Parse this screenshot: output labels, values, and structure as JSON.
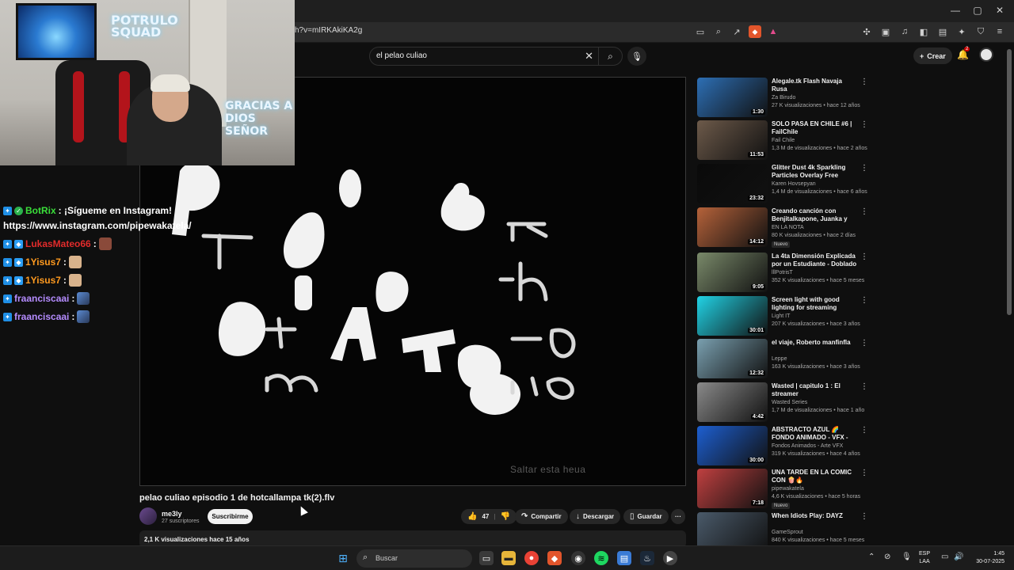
{
  "browser": {
    "url": "h?v=mIRKAkiKA2g",
    "window_controls": [
      "—",
      "▢",
      "✕"
    ]
  },
  "youtube": {
    "search_value": "el pelao culiao",
    "create_label": "Crear",
    "notification_count": "2"
  },
  "webcam": {
    "neon_sign_1": "POTRULO SQUAD",
    "neon_sign_2": "GRACIAS A DIOS SEÑOR"
  },
  "chat": [
    {
      "user": "BotRix",
      "color": "#3adf3a",
      "message": ": ¡Sígueme en Instagram!",
      "message2": "https://www.instagram.com/pipewakatela/"
    },
    {
      "user": "LukasMateo66",
      "color": "#e22b2b",
      "message": ":"
    },
    {
      "user": "1Yisus7",
      "color": "#ff9a1f",
      "message": ":"
    },
    {
      "user": "1Yisus7",
      "color": "#ff9a1f",
      "message": ":"
    },
    {
      "user": "fraanciscaai",
      "color": "#b58cff",
      "message": ":"
    },
    {
      "user": "fraanciscaai",
      "color": "#b58cff",
      "message": ":"
    }
  ],
  "video": {
    "skip_text": "Saltar esta  heua",
    "title": "pelao culiao episodio 1 de hotcallampa tk(2).flv",
    "channel": "me3ly",
    "subscribers": "27 suscriptores",
    "subscribe_label": "Suscribirme",
    "likes": "47",
    "share_label": "Compartir",
    "download_label": "Descargar",
    "save_label": "Guardar",
    "views_date": "2,1 K visualizaciones  hace 15 años"
  },
  "recommendations": [
    {
      "title": "Alegale.tk Flash Navaja Rusa",
      "channel": "Za Birudo",
      "meta": "27 K visualizaciones • hace 12 años",
      "duration": "1:30",
      "color": "#2d6fb5",
      "isnew": ""
    },
    {
      "title": "SOLO PASA EN CHILE #6 | FailChile",
      "channel": "Fail Chile",
      "meta": "1,3 M de visualizaciones • hace 2 años",
      "duration": "11:53",
      "color": "#6d5a4a",
      "isnew": ""
    },
    {
      "title": "Glitter Dust 4k Sparkling Particles Overlay Free Footage...",
      "channel": "Karen Hovsepyan",
      "meta": "1,4 M de visualizaciones • hace 6 años",
      "duration": "23:32",
      "color": "#0a0a0a",
      "isnew": ""
    },
    {
      "title": "Creando canción con Benjitalkapone, Juanka y Fran...",
      "channel": "EN LA NOTA",
      "meta": "80 K visualizaciones • hace 2 días",
      "duration": "14:12",
      "color": "#b5623a",
      "isnew": "Nuevo"
    },
    {
      "title": "La 4ta Dimensión Explicada por un Estudiante - Doblado al ...",
      "channel": "lllPotrisT",
      "meta": "352 K visualizaciones • hace 5 meses",
      "duration": "9:05",
      "color": "#7a8a6a",
      "isnew": ""
    },
    {
      "title": "Screen light with good lighting for streaming",
      "channel": "Light IT",
      "meta": "207 K visualizaciones • hace 3 años",
      "duration": "30:01",
      "color": "#21d3e6",
      "isnew": ""
    },
    {
      "title": "el viaje, Roberto manfinfla",
      "channel": "Leppe",
      "meta": "163 K visualizaciones • hace 3 años",
      "duration": "12:32",
      "color": "#7aa0b0",
      "isnew": ""
    },
    {
      "title": "Wasted | capitulo 1 : El streamer",
      "channel": "Wasted Series",
      "meta": "1,7 M de visualizaciones • hace 1 año",
      "duration": "4:42",
      "color": "#8a8a8a",
      "isnew": ""
    },
    {
      "title": "ABSTRACTO AZUL 🌈 FONDO ANIMADO - VFX - GRATIS ✅ ...",
      "channel": "Fondos Animados - Arte VFX",
      "meta": "319 K visualizaciones • hace 4 años",
      "duration": "30:00",
      "color": "#1d5fd1",
      "isnew": ""
    },
    {
      "title": "UNA TARDE EN LA COMIC CON 🍿🔥",
      "channel": "pipewakatela",
      "meta": "4,6 K visualizaciones • hace 5 horas",
      "duration": "7:18",
      "color": "#c04040",
      "isnew": "Nuevo"
    },
    {
      "title": "When Idiots Play: DAYZ",
      "channel": "GameSprout",
      "meta": "840 K visualizaciones • hace 5 meses",
      "duration": "",
      "color": "#4a5a6a",
      "isnew": ""
    }
  ],
  "taskbar": {
    "search_placeholder": "Buscar",
    "lang_1": "ESP",
    "lang_2": "LAA",
    "time": "1:45",
    "date": "30-07-2025"
  }
}
